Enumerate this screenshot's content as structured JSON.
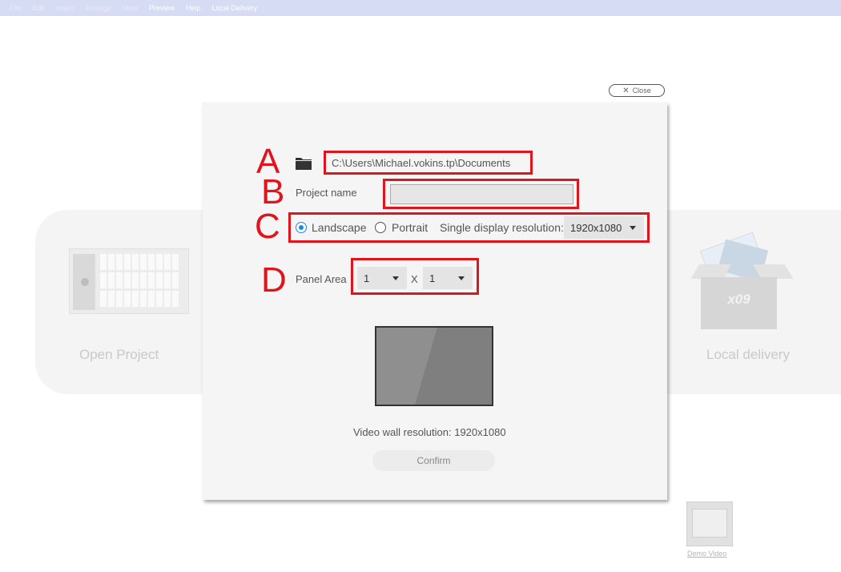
{
  "menu": {
    "items": [
      "File",
      "Edit",
      "Insert",
      "Arrange",
      "View",
      "Preview",
      "Help",
      "Local Delivery"
    ]
  },
  "background": {
    "open_project_label": "Open Project",
    "local_delivery_label": "Local delivery",
    "box_text": "x09",
    "demo_video_label": "Demo Video"
  },
  "close_button": {
    "label": "Close",
    "icon": "close-icon"
  },
  "dialog": {
    "markers": {
      "a": "A",
      "b": "B",
      "c": "C",
      "d": "D"
    },
    "folder_icon": "folder-icon",
    "path": "C:\\Users\\Michael.vokins.tp\\Documents",
    "project_name_label": "Project name",
    "project_name_value": "",
    "orientation": {
      "landscape_label": "Landscape",
      "portrait_label": "Portrait",
      "selected": "Landscape"
    },
    "resolution_label": "Single display resolution:",
    "resolution_value": "1920x1080",
    "panel_area_label": "Panel Area",
    "panel_cols": "1",
    "panel_sep": "X",
    "panel_rows": "1",
    "wall_resolution": "Video wall resolution: 1920x1080",
    "confirm_label": "Confirm"
  },
  "colors": {
    "highlight": "#e0141c",
    "radio_selected": "#1e88e5",
    "menubar": "#d7dcf5"
  }
}
